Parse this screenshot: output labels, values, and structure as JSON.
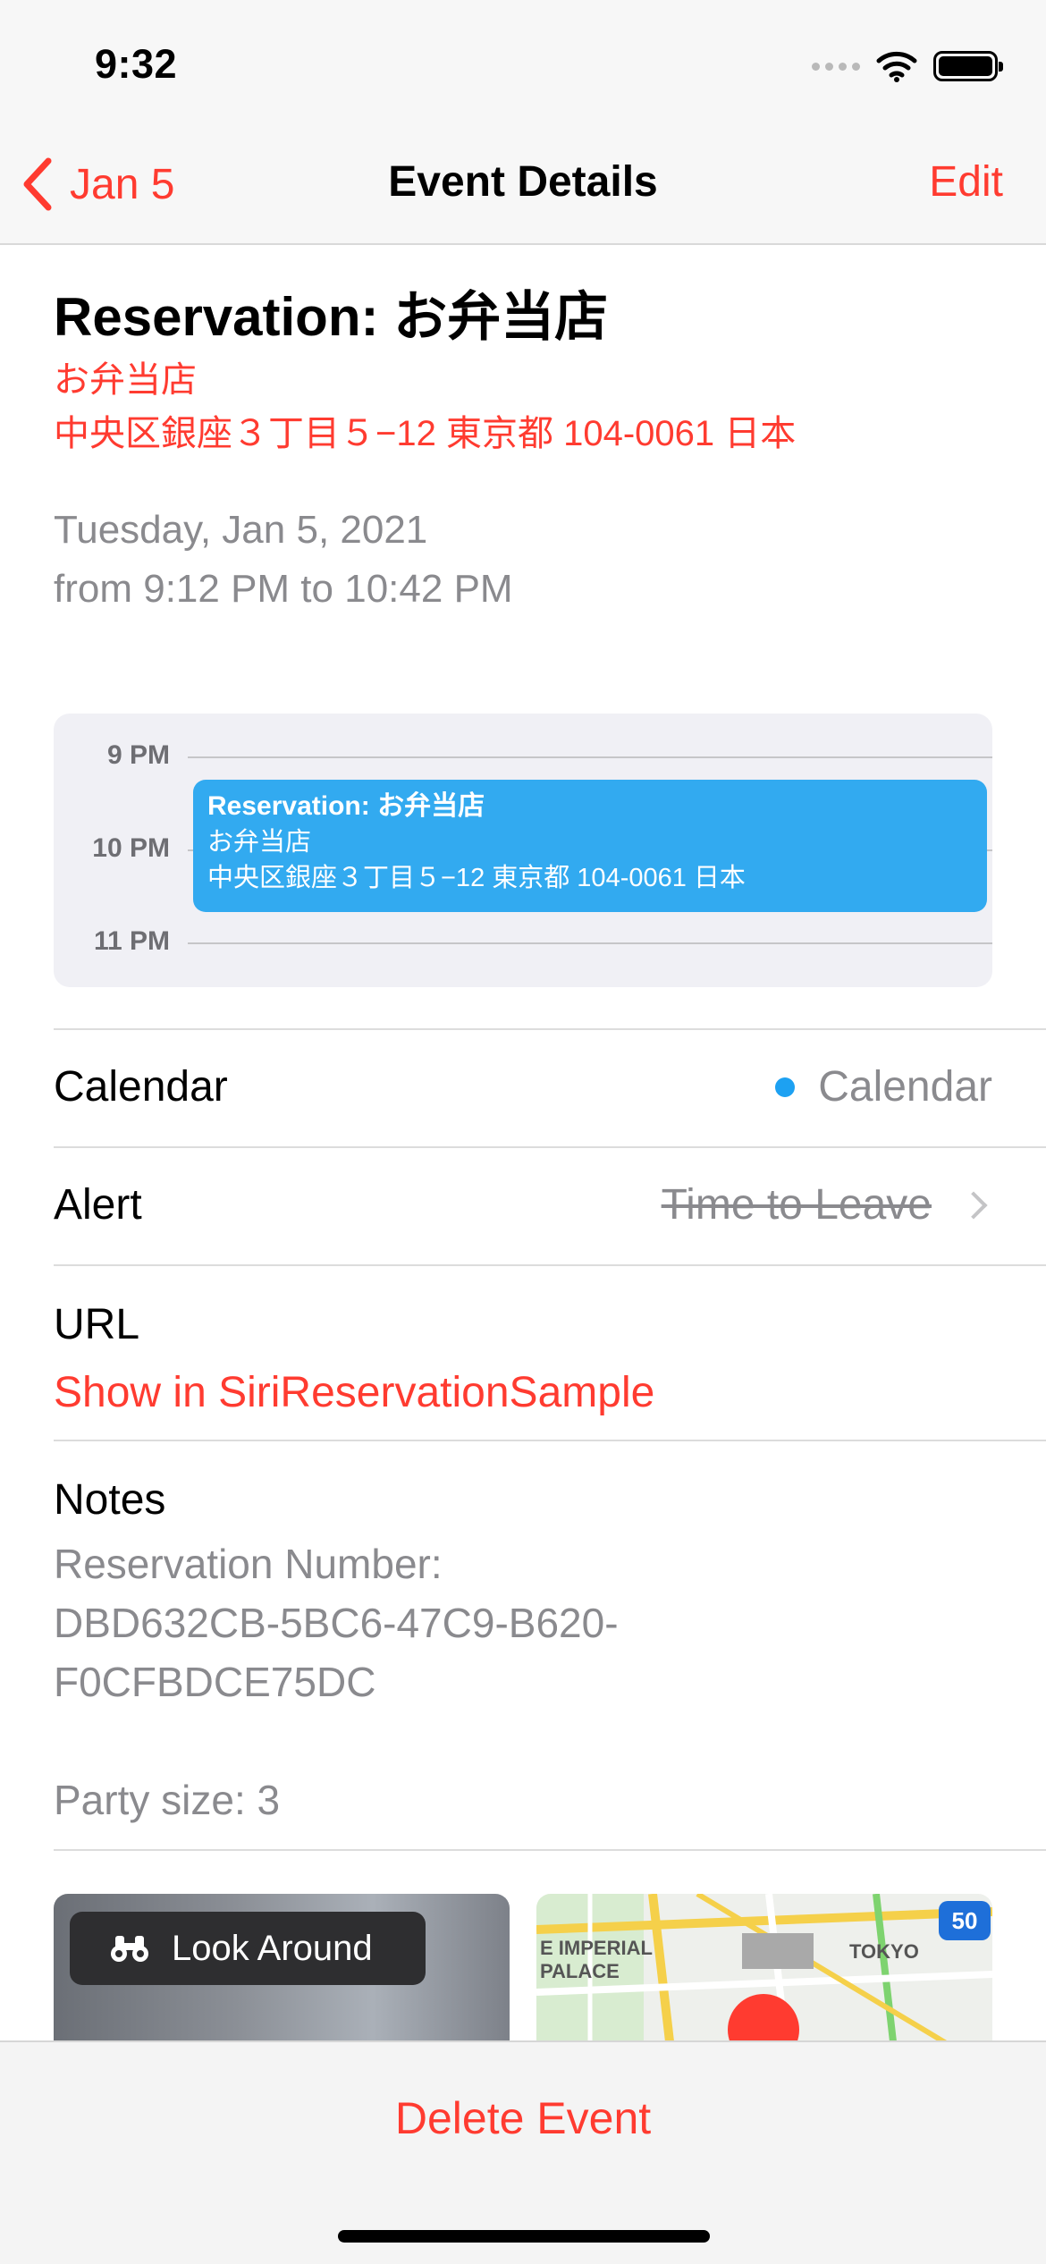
{
  "status": {
    "time": "9:32"
  },
  "nav": {
    "back_label": "Jan 5",
    "title": "Event Details",
    "edit_label": "Edit"
  },
  "event": {
    "title": "Reservation: お弁当店",
    "location_name": "お弁当店",
    "location_address": "中央区銀座３丁目５−12 東京都 104-0061 日本",
    "date": "Tuesday, Jan 5, 2021",
    "time_range": "from 9:12 PM to 10:42 PM"
  },
  "day_view": {
    "hours": [
      "9 PM",
      "10 PM",
      "11 PM"
    ],
    "block": {
      "title": "Reservation: お弁当店",
      "location_name": "お弁当店",
      "location_address": "中央区銀座３丁目５−12 東京都 104-0061 日本",
      "color": "#32aaf0"
    }
  },
  "details": {
    "calendar": {
      "label": "Calendar",
      "value": "Calendar",
      "dot_color": "#1da1f2"
    },
    "alert": {
      "label": "Alert",
      "value": "Time to Leave"
    },
    "url": {
      "label": "URL",
      "link": "Show in SiriReservationSample"
    },
    "notes": {
      "label": "Notes",
      "line1": "Reservation Number:",
      "line2": "DBD632CB-5BC6-47C9-B620-",
      "line3": "F0CFBDCE75DC",
      "party": "Party size: 3"
    }
  },
  "preview": {
    "look_around_label": "Look Around",
    "map_labels": {
      "a1": "E IMPERIAL",
      "a2": "PALACE",
      "b": "TOKYO",
      "shield": "50"
    }
  },
  "footer": {
    "delete_label": "Delete Event"
  },
  "colors": {
    "accent": "#ff3b30",
    "secondary_text": "#8a8a8e"
  }
}
